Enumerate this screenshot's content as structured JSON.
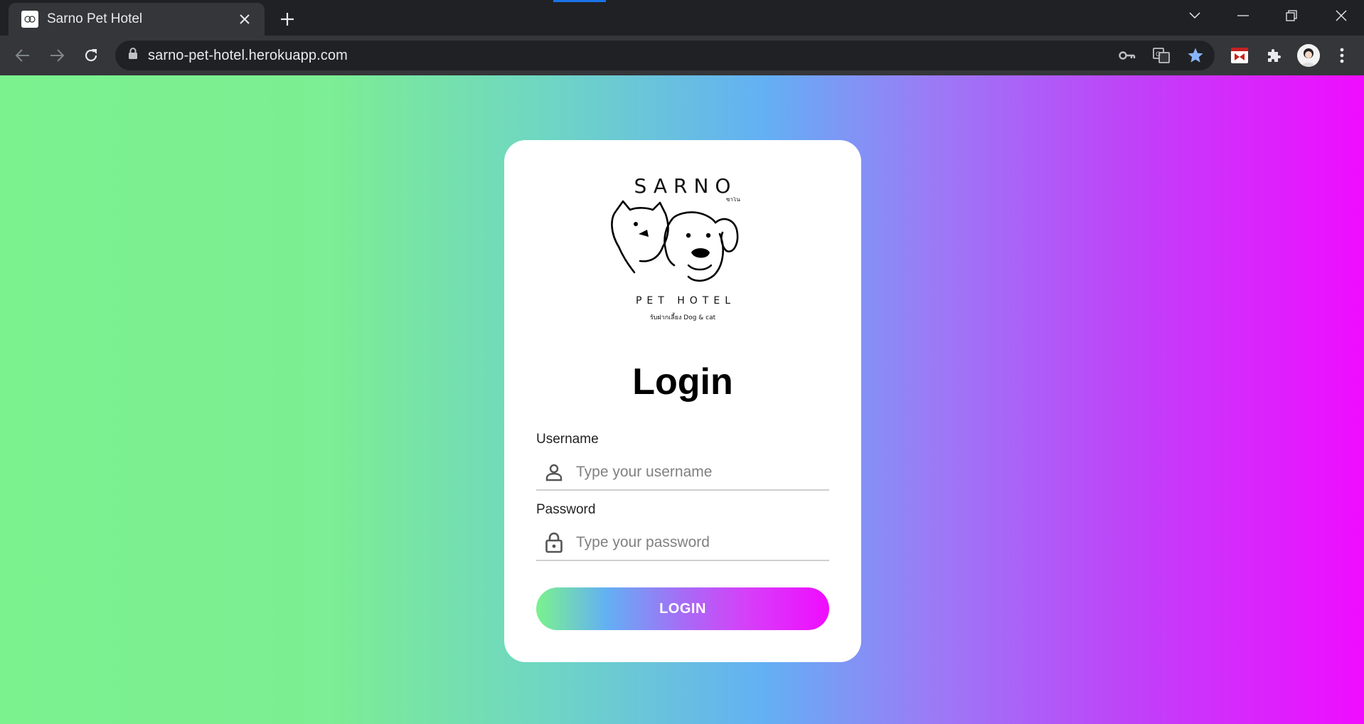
{
  "browser": {
    "tab_title": "Sarno Pet Hotel",
    "url": "sarno-pet-hotel.herokuapp.com"
  },
  "logo": {
    "title": "SARNO",
    "small_thai": "ซาโน",
    "subtitle": "PET HOTEL",
    "tagline": "รับฝากเลี้ยง Dog & cat"
  },
  "login": {
    "heading": "Login",
    "username_label": "Username",
    "username_placeholder": "Type your username",
    "password_label": "Password",
    "password_placeholder": "Type your password",
    "button_label": "LOGIN"
  },
  "colors": {
    "gradient_start": "#7bf28e",
    "gradient_mid": "#63b0f4",
    "gradient_end": "#f00cff"
  }
}
